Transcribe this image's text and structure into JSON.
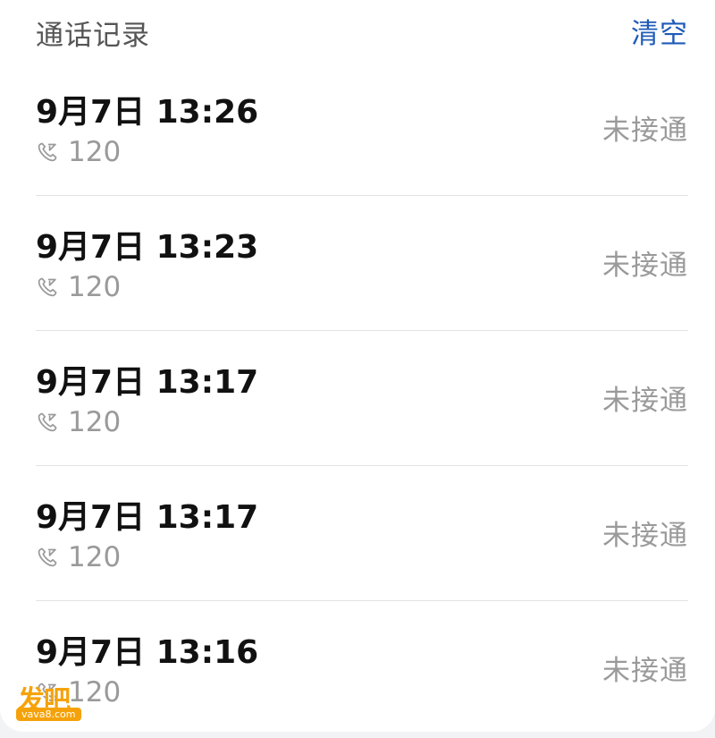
{
  "header": {
    "title": "通话记录",
    "clear_label": "清空"
  },
  "icons": {
    "call_icon": "missed-call-icon"
  },
  "colors": {
    "accent": "#1f5bb8",
    "secondary_text": "#9a9a9a",
    "primary_text": "#111111",
    "watermark": "#f5a20a"
  },
  "calls": [
    {
      "time": "9月7日 13:26",
      "number": "120",
      "status": "未接通"
    },
    {
      "time": "9月7日 13:23",
      "number": "120",
      "status": "未接通"
    },
    {
      "time": "9月7日 13:17",
      "number": "120",
      "status": "未接通"
    },
    {
      "time": "9月7日 13:17",
      "number": "120",
      "status": "未接通"
    },
    {
      "time": "9月7日 13:16",
      "number": "120",
      "status": "未接通"
    }
  ],
  "watermark": {
    "name": "发吧",
    "url": "vava8.com"
  }
}
